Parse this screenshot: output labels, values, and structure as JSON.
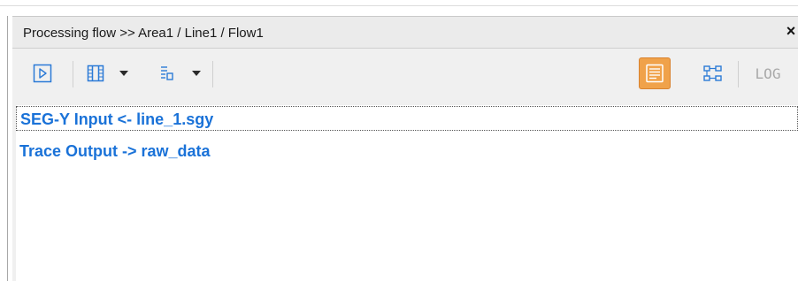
{
  "panel": {
    "title": "Processing flow >> Area1 / Line1 / Flow1",
    "close_label": "×"
  },
  "toolbar": {
    "buttons": [
      {
        "icon": "play-icon"
      },
      {
        "icon": "columns-icon",
        "has_dropdown": true
      },
      {
        "icon": "tree-layout-icon",
        "has_dropdown": true
      },
      {
        "icon": "list-view-icon",
        "active": true,
        "accent_color": "#f0a24a"
      },
      {
        "icon": "diagram-view-icon"
      },
      {
        "icon": "log-icon",
        "label": "LOG"
      }
    ]
  },
  "flow": {
    "modules": [
      {
        "label": "SEG-Y Input <- line_1.sgy",
        "selected": true
      },
      {
        "label": "Trace Output -> raw_data",
        "selected": false
      }
    ],
    "text_color": "#1a72d8"
  }
}
